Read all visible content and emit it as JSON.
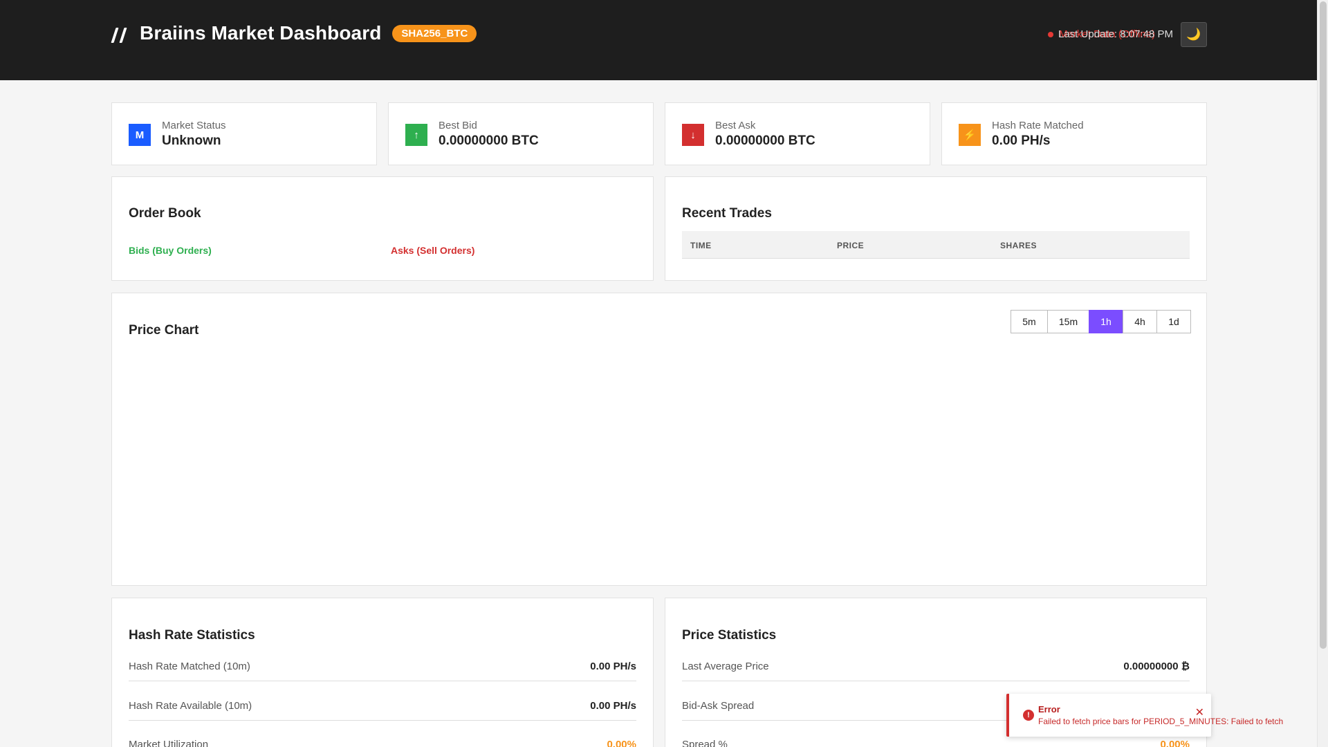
{
  "header": {
    "title": "Braiins Market Dashboard",
    "pair": "SHA256_BTC",
    "connection_status": "Market Data (Offline)",
    "last_update": "Last Update: 8:07:48 PM",
    "theme_icon": "moon-icon"
  },
  "stats": [
    {
      "icon": "M",
      "label": "Market Status",
      "value": "Unknown",
      "color": "#1a5cff"
    },
    {
      "icon": "↑",
      "label": "Best Bid",
      "value": "0.00000000 BTC",
      "color": "#2eaf4f"
    },
    {
      "icon": "↓",
      "label": "Best Ask",
      "value": "0.00000000 BTC",
      "color": "#d32f2f"
    },
    {
      "icon": "⚡",
      "label": "Hash Rate Matched",
      "value": "0.00 PH/s",
      "color": "#f7931a"
    }
  ],
  "order_book": {
    "title": "Order Book",
    "bids_label": "Bids (Buy Orders)",
    "asks_label": "Asks (Sell Orders)"
  },
  "recent_trades": {
    "title": "Recent Trades",
    "columns": [
      "TIME",
      "PRICE",
      "SHARES"
    ]
  },
  "price_chart": {
    "title": "Price Chart",
    "timeframes": [
      "5m",
      "15m",
      "1h",
      "4h",
      "1d"
    ],
    "active_timeframe": "1h"
  },
  "hash_rate_stats": {
    "title": "Hash Rate Statistics",
    "rows": [
      {
        "label": "Hash Rate Matched (10m)",
        "value": "0.00 PH/s"
      },
      {
        "label": "Hash Rate Available (10m)",
        "value": "0.00 PH/s"
      },
      {
        "label": "Market Utilization",
        "value": "0.00%"
      }
    ]
  },
  "price_stats": {
    "title": "Price Statistics",
    "rows": [
      {
        "label": "Last Average Price",
        "value": "0.00000000 ₿"
      },
      {
        "label": "Bid-Ask Spread",
        "value": ""
      },
      {
        "label": "Spread %",
        "value": "0.00%"
      }
    ]
  },
  "toast": {
    "title": "Error",
    "message": "Failed to fetch price bars for PERIOD_5_MINUTES: Failed to fetch",
    "close_label": "✕"
  }
}
